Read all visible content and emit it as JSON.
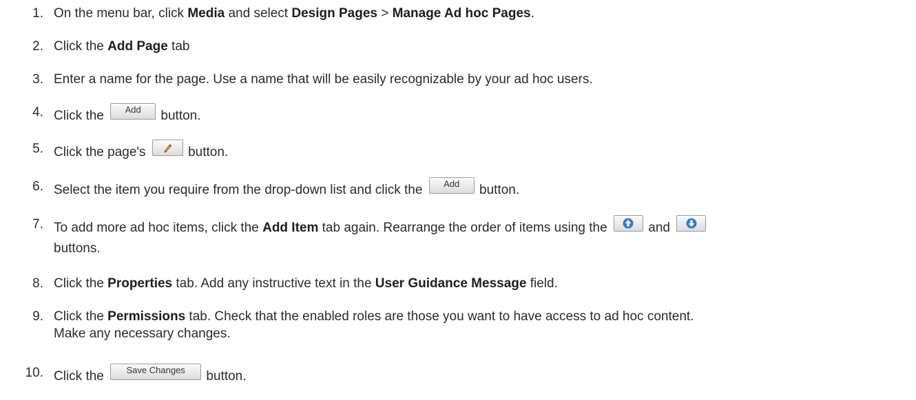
{
  "steps": [
    {
      "num": "1.",
      "parts": {
        "t1": "On the menu bar, click ",
        "b1": "Media",
        "t2": " and select ",
        "b2": "Design Pages",
        "t3": " > ",
        "b3": "Manage Ad hoc Pages",
        "t4": "."
      }
    },
    {
      "num": "2.",
      "parts": {
        "t1": "Click the ",
        "b1": "Add Page",
        "t2": " tab"
      }
    },
    {
      "num": "3.",
      "parts": {
        "t1": "Enter a name for the page. Use a name that will be easily recognizable by your ad hoc users."
      }
    },
    {
      "num": "4.",
      "parts": {
        "t1": "Click the",
        "btn": "Add",
        "t2": "button."
      }
    },
    {
      "num": "5.",
      "parts": {
        "t1": "Click the page's",
        "icon": "pencil-icon",
        "t2": "button."
      }
    },
    {
      "num": "6.",
      "parts": {
        "t1": "Select the item you require from the drop-down list and click the",
        "btn": "Add",
        "t2": "button."
      }
    },
    {
      "num": "7.",
      "parts": {
        "t1": "To add more ad hoc items, click the ",
        "b1": "Add Item",
        "t2": " tab again. Rearrange the order of items using the",
        "icon1": "arrow-up-icon",
        "t3": "and",
        "icon2": "arrow-down-icon",
        "line2": "buttons."
      }
    },
    {
      "num": "8.",
      "parts": {
        "t1": "Click the ",
        "b1": "Properties",
        "t2": " tab. Add any instructive text in the ",
        "b2": "User Guidance Message",
        "t3": " field."
      }
    },
    {
      "num": "9.",
      "parts": {
        "t1": "Click the ",
        "b1": "Permissions",
        "t2": " tab. Check that the enabled roles are those you want to have access to ad hoc content.",
        "line2": "Make any necessary changes."
      }
    },
    {
      "num": "10.",
      "parts": {
        "t1": "Click the",
        "btn": "Save Changes",
        "t2": "button."
      }
    }
  ],
  "colors": {
    "text": "#2b2b2b",
    "button_bg": "#e6e6e6",
    "button_border": "#9c9c9c",
    "icon_blue": "#2c7fd2",
    "pencil": "#d08a1a"
  }
}
